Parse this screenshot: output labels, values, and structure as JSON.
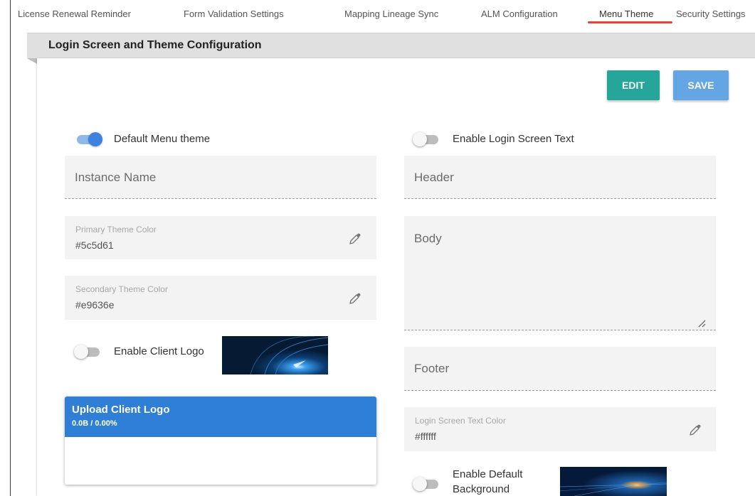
{
  "tabs": [
    {
      "label": "License Renewal Reminder"
    },
    {
      "label": "Form Validation Settings"
    },
    {
      "label": "Mapping Lineage Sync"
    },
    {
      "label": "ALM Configuration"
    },
    {
      "label": "Menu Theme",
      "active": true
    },
    {
      "label": "Security Settings"
    }
  ],
  "panel": {
    "title": "Login Screen and Theme Configuration"
  },
  "actions": {
    "edit_label": "EDIT",
    "save_label": "SAVE"
  },
  "left": {
    "default_menu_theme": {
      "label": "Default Menu theme",
      "enabled": true
    },
    "instance_name": {
      "placeholder": "Instance Name"
    },
    "primary_color": {
      "label": "Primary Theme Color",
      "value": "#5c5d61"
    },
    "secondary_color": {
      "label": "Secondary Theme Color",
      "value": "#e9636e"
    },
    "client_logo": {
      "label": "Enable Client Logo",
      "enabled": false
    },
    "upload": {
      "title": "Upload Client Logo",
      "progress": "0.0B / 0.00%"
    }
  },
  "right": {
    "login_text": {
      "label": "Enable Login Screen Text",
      "enabled": false
    },
    "header": {
      "placeholder": "Header"
    },
    "body": {
      "placeholder": "Body"
    },
    "footer": {
      "placeholder": "Footer"
    },
    "text_color": {
      "label": "Login Screen Text Color",
      "value": "#ffffff"
    },
    "default_background": {
      "label_line1": "Enable Default",
      "label_line2": "Background",
      "enabled": false
    }
  },
  "colors": {
    "accent_tab": "#e8452c",
    "edit_button": "#26a69a",
    "save_button": "#64a6e3",
    "toggle_on": "#3d82de",
    "upload_header": "#2f7fd6"
  },
  "icons": {
    "picker": "eyedropper-icon",
    "resize": "resize-handle-icon"
  }
}
